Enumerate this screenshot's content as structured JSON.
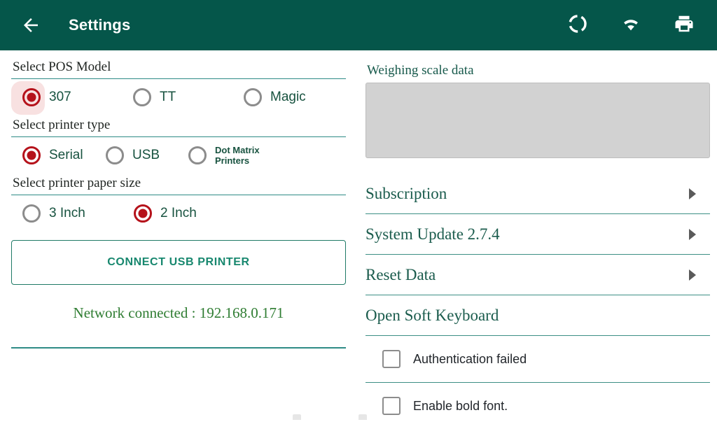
{
  "appbar": {
    "back_icon": "back-arrow-icon",
    "title": "Settings",
    "actions": [
      {
        "icon": "sync-circle-icon"
      },
      {
        "icon": "wifi-icon"
      },
      {
        "icon": "printer-icon"
      }
    ]
  },
  "left": {
    "pos_model": {
      "label": "Select POS Model",
      "options": [
        {
          "label": "307",
          "selected": true
        },
        {
          "label": "TT",
          "selected": false
        },
        {
          "label": "Magic",
          "selected": false
        }
      ]
    },
    "printer_type": {
      "label": "Select printer type",
      "options": [
        {
          "label": "Serial",
          "selected": true
        },
        {
          "label": "USB",
          "selected": false
        },
        {
          "label": "Dot Matrix\nPrinters",
          "selected": false
        }
      ]
    },
    "paper_size": {
      "label": "Select printer paper size",
      "options": [
        {
          "label": "3 Inch",
          "selected": false
        },
        {
          "label": "2 Inch",
          "selected": true
        }
      ]
    },
    "connect_button": "CONNECT USB PRINTER",
    "network_status": "Network connected : 192.168.0.171"
  },
  "right": {
    "scale_label": "Weighing scale data",
    "scale_value": "",
    "items": [
      {
        "label": "Subscription",
        "chevron": true
      },
      {
        "label": "System Update 2.7.4",
        "chevron": true
      },
      {
        "label": "Reset Data",
        "chevron": true
      },
      {
        "label": "Open Soft Keyboard",
        "chevron": false
      }
    ],
    "checkboxes": [
      {
        "label": "Authentication failed",
        "checked": false
      },
      {
        "label": "Enable bold font.",
        "checked": false
      }
    ]
  },
  "colors": {
    "appbar": "#05564a",
    "accent_teal": "#2e8b86",
    "radio_selected": "#b5121b",
    "ripple": "#f7dcdc",
    "status_green": "#2f7d32",
    "scale_box": "#d2d2d2"
  }
}
